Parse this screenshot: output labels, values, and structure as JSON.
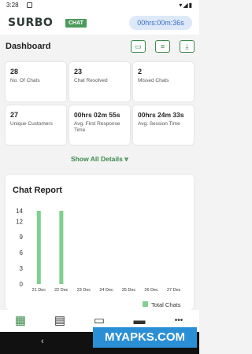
{
  "status_bar": {
    "time": "3:28",
    "signal": "▾◢▮"
  },
  "header": {
    "logo": "SURBO",
    "logo_badge": "CHAT",
    "timer": "00hrs:00m:36s"
  },
  "dashboard": {
    "title": "Dashboard",
    "tools": [
      {
        "icon": "briefcase-icon",
        "glyph": "▭"
      },
      {
        "icon": "filter-list-icon",
        "glyph": "≡"
      },
      {
        "icon": "download-icon",
        "glyph": "⤓"
      }
    ],
    "stats": [
      {
        "value": "28",
        "label": "No. Of Chats"
      },
      {
        "value": "23",
        "label": "Chat Resolved"
      },
      {
        "value": "2",
        "label": "Missed Chats"
      },
      {
        "value": "27",
        "label": "Unique Customers"
      },
      {
        "value": "00hrs 02m 55s",
        "label": "Avg. First Response Time"
      },
      {
        "value": "00hrs 24m 33s",
        "label": "Avg. Session Time"
      }
    ],
    "show_all": "Show All Details  ⩔"
  },
  "chart_data": {
    "type": "bar",
    "title": "Chat Report",
    "categories": [
      "21 Dec",
      "22 Dec",
      "23 Dec",
      "24 Dec",
      "25 Dec",
      "26 Dec",
      "27 Dec"
    ],
    "series": [
      {
        "name": "Total Chats",
        "values": [
          14,
          14,
          0,
          0,
          0,
          0,
          0
        ],
        "color": "#7ed08e"
      }
    ],
    "ylim": [
      0,
      14
    ],
    "yticks": [
      0,
      3,
      6,
      9,
      12,
      14
    ],
    "legend": "bottom-right"
  },
  "bottom_nav": [
    {
      "name": "dashboard-icon",
      "glyph": "▦"
    },
    {
      "name": "reports-icon",
      "glyph": "▤"
    },
    {
      "name": "chat-icon",
      "glyph": "▭"
    },
    {
      "name": "inbox-icon",
      "glyph": "▬"
    },
    {
      "name": "more-icon",
      "glyph": "•••"
    }
  ],
  "system_nav": {
    "back": "‹"
  },
  "watermark": "MYAPKS.COM"
}
